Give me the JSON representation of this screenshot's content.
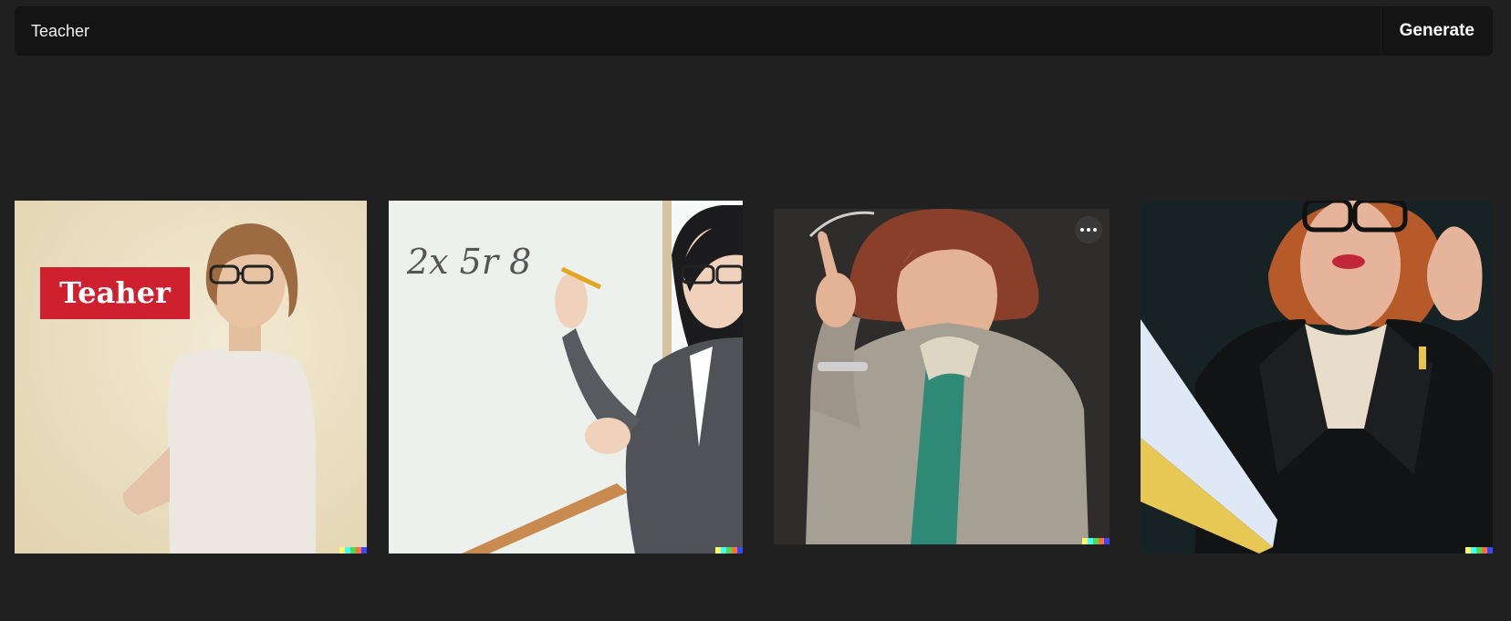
{
  "prompt": {
    "value": "Teacher",
    "generate_label": "Generate"
  },
  "images": [
    {
      "sign_text": "Teaher",
      "description_icon": "image-icon"
    },
    {
      "board_text": "2x 5r 8",
      "description_icon": "image-icon"
    },
    {
      "description_icon": "image-icon"
    },
    {
      "description_icon": "image-icon"
    }
  ],
  "watermark_colors": [
    "#ffff66",
    "#42ffff",
    "#51da4c",
    "#ff6e3c",
    "#3c46ff"
  ],
  "colors": {
    "page_background": "#202020",
    "prompt_background": "#141414",
    "text": "#ffffff"
  }
}
